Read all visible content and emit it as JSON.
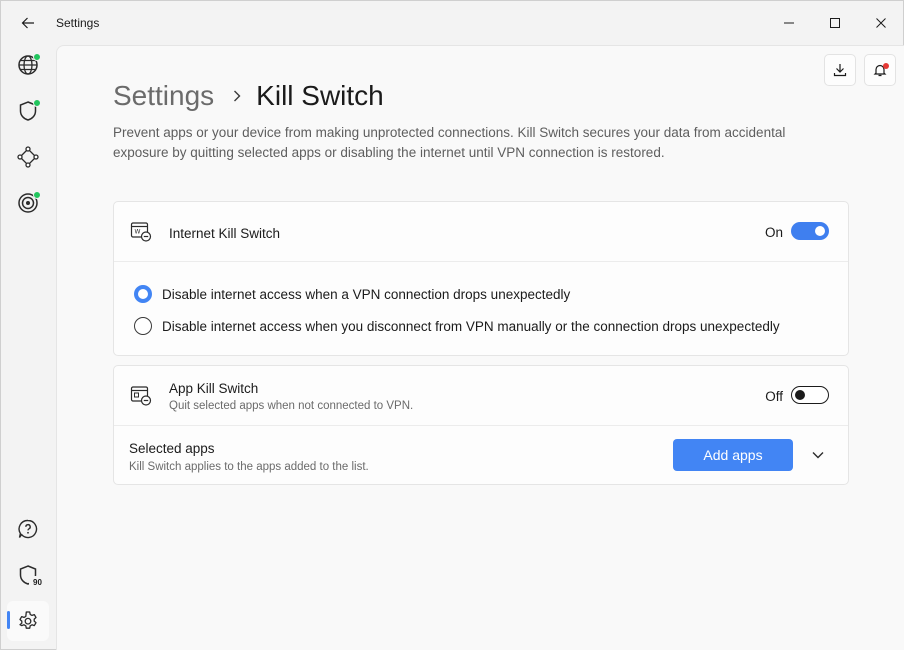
{
  "window": {
    "title": "Settings"
  },
  "breadcrumb": {
    "parent": "Settings",
    "current": "Kill Switch"
  },
  "description": "Prevent apps or your device from making unprotected connections. Kill Switch secures your data from accidental exposure by quitting selected apps or disabling the internet until VPN connection is restored.",
  "internet_kill_switch": {
    "title": "Internet Kill Switch",
    "state_label": "On",
    "enabled": true,
    "options": [
      {
        "label": "Disable internet access when a VPN connection drops unexpectedly",
        "selected": true
      },
      {
        "label": "Disable internet access when you disconnect from VPN manually or the connection drops unexpectedly",
        "selected": false
      }
    ]
  },
  "app_kill_switch": {
    "title": "App Kill Switch",
    "subtitle": "Quit selected apps when not connected to VPN.",
    "state_label": "Off",
    "enabled": false,
    "selected_apps": {
      "title": "Selected apps",
      "subtitle": "Kill Switch applies to the apps added to the list.",
      "button_label": "Add apps"
    }
  },
  "rail": {
    "badge": "90",
    "items": [
      "globe-icon",
      "shield-icon",
      "network-icon",
      "target-icon",
      "help-icon",
      "shield-badge-icon",
      "gear-icon"
    ]
  },
  "colors": {
    "accent": "#4285f4",
    "status_green": "#22c55e",
    "notification_red": "#e53935"
  }
}
